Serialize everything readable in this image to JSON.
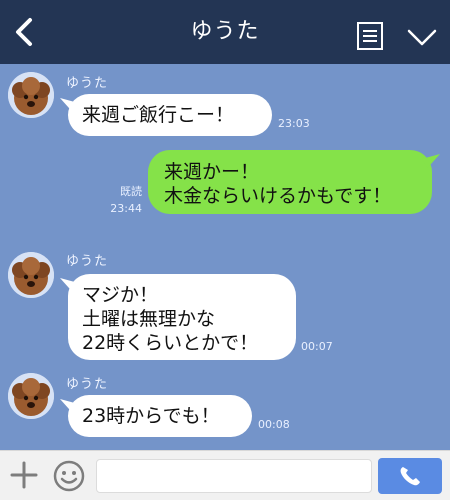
{
  "header": {
    "title": "ゆうた",
    "back_icon": "chevron-left-icon",
    "notes_icon": "notes-icon",
    "menu_icon": "chevron-down-icon",
    "background": "#233554"
  },
  "chat": {
    "background": "#7494c9",
    "messages": [
      {
        "direction": "in",
        "sender": "ゆうた",
        "text": "来週ご飯行こー！",
        "time": "23:03"
      },
      {
        "direction": "out",
        "text": "来週かー！\n木金ならいけるかもです！",
        "read": "既読",
        "time": "23:44"
      },
      {
        "direction": "in",
        "sender": "ゆうた",
        "text": "マジか！\n土曜は無理かな\n22時くらいとかで！",
        "time": "00:07"
      },
      {
        "direction": "in",
        "sender": "ゆうた",
        "text": "23時からでも！",
        "time": "00:08"
      }
    ],
    "incoming_bubble_color": "#ffffff",
    "outgoing_bubble_color": "#85e249"
  },
  "input_bar": {
    "plus_icon": "plus-icon",
    "emoji_icon": "smiley-icon",
    "message_value": "",
    "send_icon": "phone-icon",
    "send_color": "#5a8be3"
  }
}
